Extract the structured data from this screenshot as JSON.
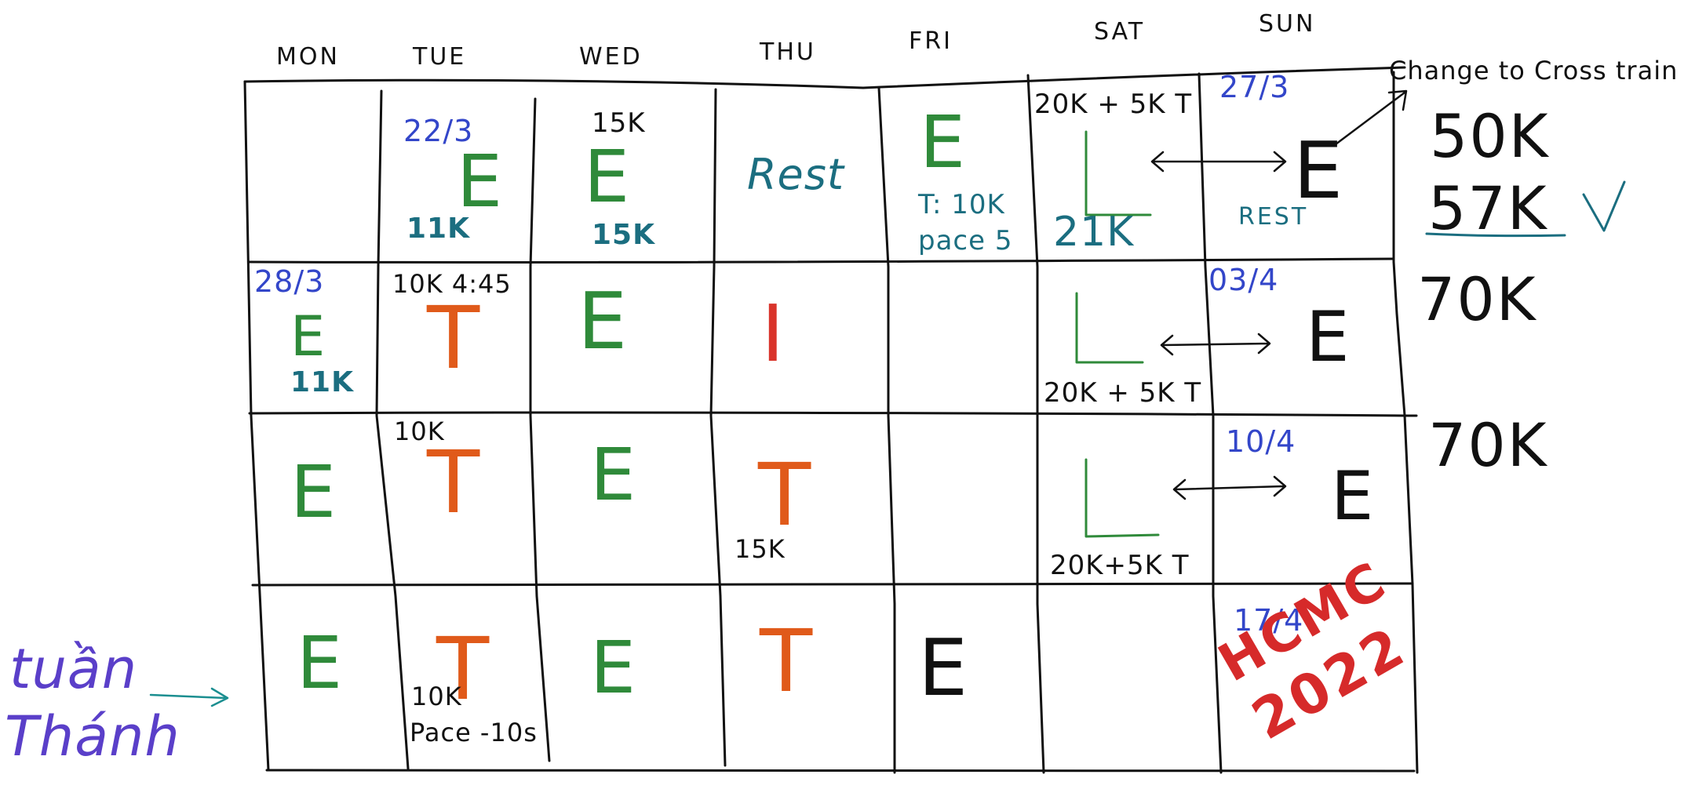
{
  "days": [
    "MON",
    "TUE",
    "WED",
    "THU",
    "FRI",
    "SAT",
    "SUN"
  ],
  "colors": {
    "easy": "#2f8a3a",
    "tempo": "#e05a1a",
    "interval": "#d9342b",
    "date": "#3346c9",
    "teal": "#1b6e80",
    "race": "#d62a2a",
    "signature": "#5a3fc9",
    "ink": "#111111"
  },
  "week1": {
    "tue": {
      "date": "22/3",
      "letter": "E",
      "dist": "11K"
    },
    "wed": {
      "top": "15K",
      "letter": "E",
      "dist": "15K"
    },
    "thu": {
      "label": "Rest"
    },
    "fri": {
      "letter": "E",
      "line1": "T: 10K",
      "line2": "pace 5"
    },
    "sat": {
      "top": "20K + 5K T",
      "letter": "L",
      "dist": "21K"
    },
    "sun": {
      "date": "27/3",
      "letter": "E",
      "sub": "REST"
    },
    "note": "Change to Cross train",
    "total": "50K",
    "actual": "57K",
    "check": "✓"
  },
  "week2": {
    "mon": {
      "date": "28/3",
      "letter": "E",
      "dist": "11K"
    },
    "tue": {
      "top": "10K 4:45",
      "letter": "T"
    },
    "wed": {
      "letter": "E"
    },
    "thu": {
      "letter": "I"
    },
    "sat": {
      "letter": "L",
      "bottom": "20K + 5K T"
    },
    "sun": {
      "date": "03/4",
      "letter": "E"
    },
    "total": "70K"
  },
  "week3": {
    "mon": {
      "letter": "E"
    },
    "tue": {
      "top": "10K",
      "letter": "T"
    },
    "wed": {
      "letter": "E"
    },
    "thu": {
      "letter": "T",
      "dist": "15K"
    },
    "sat": {
      "letter": "L",
      "bottom": "20K+5K T"
    },
    "sun": {
      "date": "10/4",
      "letter": "E"
    },
    "total": "70K"
  },
  "week4": {
    "mon": {
      "letter": "E"
    },
    "tue": {
      "letter": "T",
      "dist": "10K",
      "pace": "Pace -10s"
    },
    "wed": {
      "letter": "E"
    },
    "thu": {
      "letter": "T"
    },
    "fri": {
      "letter": "E"
    },
    "sun": {
      "date": "17/4",
      "race1": "HCMC",
      "race2": "2022"
    },
    "label1": "tuần",
    "label2": "Thánh"
  }
}
